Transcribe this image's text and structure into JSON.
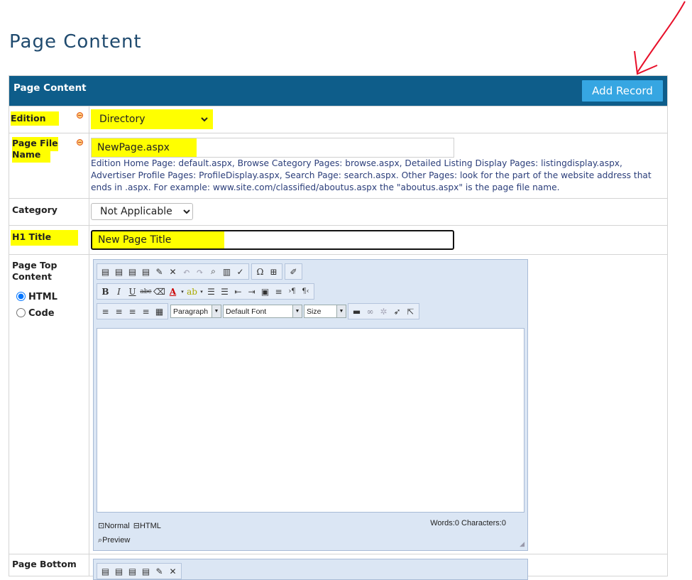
{
  "page": {
    "title": "Page Content"
  },
  "header": {
    "title": "Page Content",
    "add_button": "Add Record"
  },
  "fields": {
    "edition": {
      "label": "Edition",
      "value": "Directory"
    },
    "page_file_name": {
      "label": "Page File Name",
      "value": "NewPage.aspx",
      "hint": "Edition Home Page: default.aspx, Browse Category Pages: browse.aspx, Detailed Listing Display Pages: listingdisplay.aspx, Advertiser Profile Pages: ProfileDisplay.aspx, Search Page: search.aspx. Other Pages: look for the part of the website address that ends in .aspx. For example: www.site.com/classified/aboutus.aspx the \"aboutus.aspx\" is the page file name."
    },
    "category": {
      "label": "Category",
      "value": "Not Applicable"
    },
    "h1_title": {
      "label": "H1 Title",
      "value": "New Page Title"
    },
    "page_top_content": {
      "label": "Page Top Content",
      "mode_html": "HTML",
      "mode_code": "Code",
      "selected_mode": "HTML"
    },
    "page_bottom": {
      "label": "Page Bottom"
    }
  },
  "editor": {
    "paragraph": "Paragraph",
    "font": "Default Font",
    "size": "Size",
    "mode_normal": "Normal",
    "mode_html": "HTML",
    "mode_preview": "Preview",
    "word_count": "Words:0 Characters:0"
  },
  "colors": {
    "header_bg": "#0e5d8a",
    "button_bg": "#36a6e2",
    "highlight": "#ffff00",
    "annotation": "#e8102a"
  }
}
